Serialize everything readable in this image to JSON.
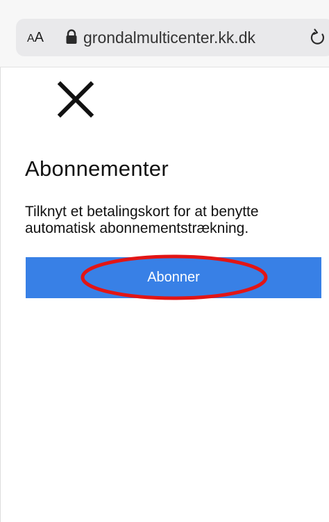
{
  "browser": {
    "reader_small_a": "A",
    "reader_large_a": "A",
    "url": "grondalmulticenter.kk.dk",
    "lock_icon": "lock-icon",
    "reload_icon": "reload-icon"
  },
  "page": {
    "close_icon": "close-icon",
    "heading": "Abonnementer",
    "description": "Tilknyt et betalingskort for at benytte automatisk abonnementstrækning.",
    "subscribe_label": "Abonner"
  },
  "colors": {
    "button_bg": "#3880e6",
    "annotation": "#e21515"
  }
}
